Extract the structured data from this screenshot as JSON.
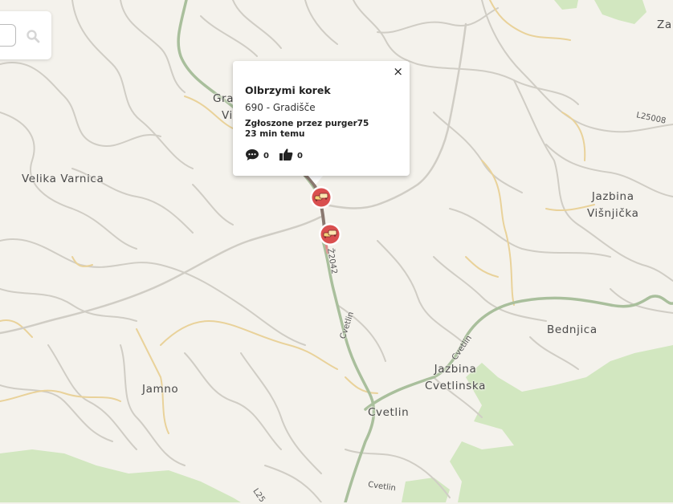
{
  "search": {
    "placeholder": ""
  },
  "map": {
    "places": [
      {
        "id": "zab",
        "name": "Zab"
      },
      {
        "id": "gra",
        "name": "Gra"
      },
      {
        "id": "vi",
        "name": "Vi"
      },
      {
        "id": "velika-varnica",
        "name": "Velika Varnica"
      },
      {
        "id": "jazbina-visnjicka",
        "name": "Jazbina\nVišnjička"
      },
      {
        "id": "bednjica",
        "name": "Bednjica"
      },
      {
        "id": "jazbina-cvetlinska",
        "name": "Jazbina\nCvetlinska"
      },
      {
        "id": "jamno",
        "name": "Jamno"
      },
      {
        "id": "cvetlin",
        "name": "Cvetlin"
      }
    ],
    "road_labels": {
      "l25008": "L25008",
      "z2042": "Ž2042",
      "cvetlin_a": "Cvetlin",
      "cvetlin_b": "Cvetlin",
      "cvetlin_c": "Cvetlin",
      "l25_bottom": "L25"
    },
    "colors": {
      "background": "#f4f2ec",
      "green": "#d2e7c0",
      "main_road": "#a9bf9c",
      "minor_road": "#d0cdc5",
      "yellow_road": "#e9d29a",
      "traffic_jam": "#8a7870",
      "alert_red": "#d94f4f"
    }
  },
  "popup": {
    "title": "Olbrzymi korek",
    "location": "690 - Gradišče",
    "reported_by_prefix": "Zgłoszone przez",
    "reported_by_user": "purger75",
    "time_ago": "23 min temu",
    "comments_count": "0",
    "likes_count": "0",
    "close_label": "×",
    "icons": [
      "comment-icon",
      "thumbs-up-icon",
      "close-icon"
    ]
  },
  "markers": [
    {
      "id": "jam-marker-1",
      "type": "traffic-jam"
    },
    {
      "id": "jam-marker-2",
      "type": "traffic-jam"
    }
  ]
}
